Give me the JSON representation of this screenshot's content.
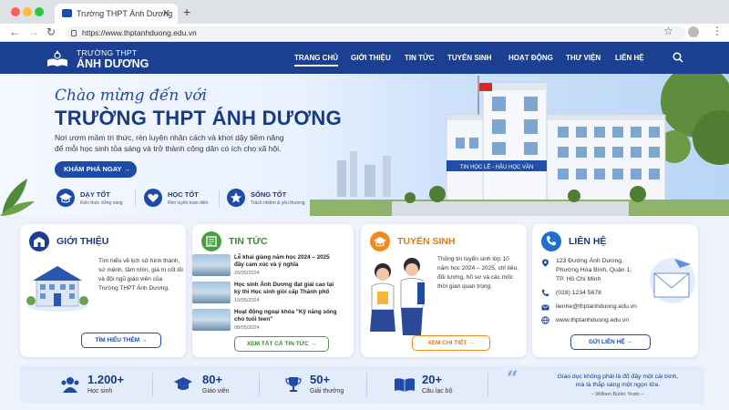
{
  "browser": {
    "tab_title": "Trường THPT Ánh Dương",
    "tab_close": "✕",
    "new_tab": "+",
    "url": "https://www.thptanhduong.edu.vn"
  },
  "site": {
    "logo_line1": "TRƯỜNG THPT",
    "logo_line2": "ÁNH DƯƠNG",
    "menu": [
      "TRANG CHỦ",
      "GIỚI THIỆU",
      "TIN TỨC",
      "TUYỂN SINH",
      "HOẠT ĐỘNG",
      "THƯ VIỆN",
      "LIÊN HỆ"
    ],
    "active_menu": "TRANG CHỦ"
  },
  "hero": {
    "welcome": "Chào mừng đến với",
    "title": "TRƯỜNG THPT ÁNH DƯƠNG",
    "desc_line1": "Nơi ươm mầm tri thức, rèn luyện nhân cách và khơi dậy tiềm năng",
    "desc_line2": "để mỗi học sinh tỏa sáng và trở thành công dân có ích cho xã hội.",
    "cta": "KHÁM PHÁ NGAY →",
    "building_sign": "TIN HỌC LỄ - HẬU HỌC VĂN",
    "features": [
      {
        "title": "DẠY TỐT",
        "sub": "Kiến thức vững vàng"
      },
      {
        "title": "HỌC TỐT",
        "sub": "Rèn luyện toàn diện"
      },
      {
        "title": "SỐNG TỐT",
        "sub": "Trách nhiệm & yêu thương"
      }
    ]
  },
  "cards": {
    "intro": {
      "title": "GIỚI THIỆU",
      "text": [
        "Tìm hiểu về lịch sử hình thành,",
        "sứ mệnh, tầm nhìn, giá trị cốt lõi",
        "và đội ngũ giáo viên của",
        "Trường THPT Ánh Dương."
      ],
      "button": "TÌM HIỂU THÊM →"
    },
    "news": {
      "title": "TIN TỨC",
      "items": [
        {
          "title": "Lễ khai giảng năm học 2024 – 2025 đầy cảm xúc và ý nghĩa",
          "date": "20/05/2024"
        },
        {
          "title": "Học sinh Ánh Dương đạt giải cao tại kỳ thi Học sinh giỏi cấp Thành phố",
          "date": "10/05/2024"
        },
        {
          "title": "Hoạt động ngoại khóa \"Kỹ năng sống cho tuổi teen\"",
          "date": "08/05/2024"
        }
      ],
      "button": "XEM TẤT CẢ TIN TỨC →"
    },
    "admission": {
      "title": "TUYỂN SINH",
      "text": [
        "Thông tin tuyển sinh lớp 10",
        "năm học 2024 – 2025, chỉ tiêu,",
        "đối tượng, hồ sơ và các mốc",
        "thời gian quan trọng."
      ],
      "button": "XEM CHI TIẾT →"
    },
    "contact": {
      "title": "LIÊN HỆ",
      "address": [
        "123 Đường Ánh Dương,",
        "Phường Hòa Bình, Quận 1,",
        "TP. Hồ Chí Minh"
      ],
      "phone": "(028) 1234 5678",
      "email": "lienhe@thptanhduong.edu.vn",
      "web": "www.thptanhduong.edu.vn",
      "button": "GỬI LIÊN HỆ →"
    }
  },
  "stats": [
    {
      "value": "1.200+",
      "label": "Học sinh"
    },
    {
      "value": "80+",
      "label": "Giáo viên"
    },
    {
      "value": "50+",
      "label": "Giải thưởng"
    },
    {
      "value": "20+",
      "label": "Câu lạc bộ"
    }
  ],
  "quote": {
    "line1": "Giáo dục không phải là đổ đầy một cái bình,",
    "line2": "mà là thắp sáng một ngọn lửa.",
    "author": "– William Butler Yeats –"
  },
  "colors": {
    "brand": "#1b3f91",
    "green": "#4a9e3f",
    "orange": "#f08a1c",
    "blue": "#1e6fd0"
  }
}
